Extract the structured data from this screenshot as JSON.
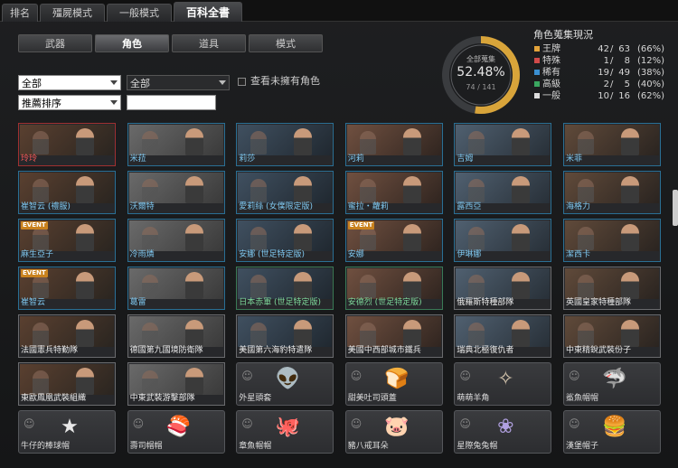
{
  "top_tabs": [
    "排名",
    "殭屍模式",
    "一般模式",
    "百科全書"
  ],
  "sub_tabs": [
    "武器",
    "角色",
    "道具",
    "模式"
  ],
  "filters": {
    "filter1": "全部",
    "filter2": "全部",
    "sort": "推薦排序",
    "show_unowned": "查看未擁有角色"
  },
  "collection": {
    "label": "全部蒐集",
    "percent": "52.48%",
    "count": "74 / 141",
    "fraction": 0.5248
  },
  "stats": {
    "title": "角色蒐集現況",
    "rows": [
      {
        "name": "王牌",
        "a": "42",
        "b": "63",
        "p": "(66%)",
        "color": "#e3a33a"
      },
      {
        "name": "特殊",
        "a": "1",
        "b": "8",
        "p": "(12%)",
        "color": "#d14a4a"
      },
      {
        "name": "稀有",
        "a": "19",
        "b": "49",
        "p": "(38%)",
        "color": "#3a8fd1"
      },
      {
        "name": "高級",
        "a": "2",
        "b": "5",
        "p": "(40%)",
        "color": "#3aa760"
      },
      {
        "name": "一般",
        "a": "10",
        "b": "16",
        "p": "(62%)",
        "color": "#dddddd"
      }
    ]
  },
  "cards": [
    {
      "name": "玲玲",
      "rarity": "r"
    },
    {
      "name": "米菈",
      "rarity": "b"
    },
    {
      "name": "莉莎",
      "rarity": "b"
    },
    {
      "name": "河莉",
      "rarity": "b"
    },
    {
      "name": "吉姆",
      "rarity": "b"
    },
    {
      "name": "米菲",
      "rarity": "b"
    },
    {
      "name": "崔智云 (禮服)",
      "rarity": "b"
    },
    {
      "name": "沃爾特",
      "rarity": "b"
    },
    {
      "name": "愛莉絲 (女僕限定版)",
      "rarity": "b"
    },
    {
      "name": "蜜拉・蘿莉",
      "rarity": "b"
    },
    {
      "name": "露西亞",
      "rarity": "b"
    },
    {
      "name": "海格力",
      "rarity": "b"
    },
    {
      "name": "麻生亞子",
      "rarity": "b",
      "event": "EVENT"
    },
    {
      "name": "冷雨燐",
      "rarity": "b"
    },
    {
      "name": "安娜 (世足特定版)",
      "rarity": "b"
    },
    {
      "name": "安娜",
      "rarity": "b",
      "event": "EVENT"
    },
    {
      "name": "伊琳娜",
      "rarity": "b"
    },
    {
      "name": "潔西卡",
      "rarity": "b"
    },
    {
      "name": "崔智云",
      "rarity": "b",
      "event": "EVENT"
    },
    {
      "name": "葛雷",
      "rarity": "b"
    },
    {
      "name": "日本赤軍 (世足特定版)",
      "rarity": "g"
    },
    {
      "name": "安德烈 (世足特定版)",
      "rarity": "g"
    },
    {
      "name": "俄羅斯特種部隊",
      "rarity": "w"
    },
    {
      "name": "英國皇家特種部隊",
      "rarity": "w"
    },
    {
      "name": "法國憲兵特勤隊",
      "rarity": "w"
    },
    {
      "name": "德國第九國境防衛隊",
      "rarity": "w"
    },
    {
      "name": "美國第六海豹特遣隊",
      "rarity": "w"
    },
    {
      "name": "美國中西部城市鐵兵",
      "rarity": "w"
    },
    {
      "name": "瑞典北極復仇者",
      "rarity": "w"
    },
    {
      "name": "中東精銳武裝份子",
      "rarity": "w"
    },
    {
      "name": "東歐鳳凰武裝組織",
      "rarity": "w"
    },
    {
      "name": "中東武裝游擊部隊",
      "rarity": "w"
    },
    {
      "name": "外星頭套",
      "rarity": "item",
      "icon": "alien-mask-icon"
    },
    {
      "name": "甜美吐司頭蓋",
      "rarity": "item",
      "icon": "toast-hat-icon"
    },
    {
      "name": "萌萌羊角",
      "rarity": "item",
      "icon": "sheep-horns-icon"
    },
    {
      "name": "鯊魚帽帽",
      "rarity": "item",
      "icon": "shark-hat-icon"
    },
    {
      "name": "牛仔的棒球帽",
      "rarity": "item",
      "icon": "cowboy-cap-icon"
    },
    {
      "name": "壽司帽帽",
      "rarity": "item",
      "icon": "sushi-hat-icon"
    },
    {
      "name": "章魚帽帽",
      "rarity": "item",
      "icon": "octopus-hat-icon"
    },
    {
      "name": "豬八戒耳朵",
      "rarity": "item",
      "icon": "pig-ears-icon"
    },
    {
      "name": "星際兔兔帽",
      "rarity": "item",
      "icon": "space-bunny-hat-icon"
    },
    {
      "name": "漢堡帽子",
      "rarity": "item",
      "icon": "burger-hat-icon"
    }
  ]
}
